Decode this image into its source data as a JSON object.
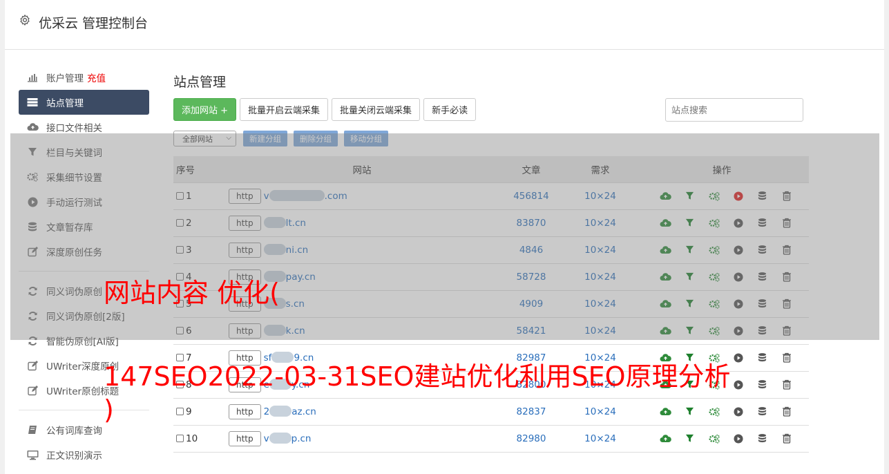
{
  "header": {
    "title": "优采云 管理控制台"
  },
  "sidebar": {
    "group1": [
      {
        "label": "账户管理",
        "extra": "充值",
        "icon": "bar-chart-icon"
      },
      {
        "label": "站点管理",
        "icon": "server-list-icon",
        "active": true
      },
      {
        "label": "接口文件相关",
        "icon": "cloud-upload-icon"
      },
      {
        "label": "栏目与关键词",
        "icon": "filter-icon"
      },
      {
        "label": "采集细节设置",
        "icon": "cogs-icon"
      },
      {
        "label": "手动运行测试",
        "icon": "play-circle-icon"
      },
      {
        "label": "文章暂存库",
        "icon": "database-icon"
      },
      {
        "label": "深度原创任务",
        "icon": "edit-icon"
      }
    ],
    "group2": [
      {
        "label": "同义词伪原创",
        "icon": "refresh-icon"
      },
      {
        "label": "同义词伪原创[2版]",
        "icon": "refresh-icon"
      },
      {
        "label": "智能伪原创[AI版]",
        "icon": "refresh-icon"
      },
      {
        "label": "UWriter深度原创",
        "icon": "edit-icon"
      },
      {
        "label": "UWriter原创标题",
        "icon": "edit-icon"
      }
    ],
    "group3": [
      {
        "label": "公有词库查询",
        "icon": "book-icon"
      },
      {
        "label": "正文识别演示",
        "icon": "monitor-icon"
      }
    ]
  },
  "main": {
    "title": "站点管理",
    "add_button": "添加网站 +",
    "batch_open": "批量开启云端采集",
    "batch_close": "批量关闭云端采集",
    "guide": "新手必读",
    "search_placeholder": "站点搜索",
    "group_select": "全部网站",
    "new_group": "新建分组",
    "delete_group": "删除分组",
    "move_group": "移动分组"
  },
  "table": {
    "headers": {
      "no": "序号",
      "site": "网站",
      "articles": "文章",
      "demand": "需求",
      "ops": "操作"
    },
    "rows": [
      {
        "no": "1",
        "scheme": "http",
        "prefix": "v",
        "suffix": ".com",
        "articles": "456814",
        "demand": "10×24",
        "running": true
      },
      {
        "no": "2",
        "scheme": "http",
        "prefix": "",
        "suffix": "lt.cn",
        "articles": "83870",
        "demand": "10×24",
        "running": false
      },
      {
        "no": "3",
        "scheme": "http",
        "prefix": "",
        "suffix": "ni.cn",
        "articles": "4846",
        "demand": "10×24",
        "running": false
      },
      {
        "no": "4",
        "scheme": "http",
        "prefix": "",
        "suffix": "pay.cn",
        "articles": "58728",
        "demand": "10×24",
        "running": false
      },
      {
        "no": "5",
        "scheme": "http",
        "prefix": "",
        "suffix": "s.cn",
        "articles": "4909",
        "demand": "10×24",
        "running": false
      },
      {
        "no": "6",
        "scheme": "http",
        "prefix": "",
        "suffix": "k.cn",
        "articles": "58421",
        "demand": "10×24",
        "running": false
      },
      {
        "no": "7",
        "scheme": "http",
        "prefix": "sf",
        "suffix": "9.cn",
        "articles": "82987",
        "demand": "10×24",
        "running": false
      },
      {
        "no": "8",
        "scheme": "http",
        "prefix": "e",
        "suffix": "y.cn",
        "articles": "82800",
        "demand": "10×24",
        "running": false
      },
      {
        "no": "9",
        "scheme": "http",
        "prefix": "2",
        "suffix": "az.cn",
        "articles": "82837",
        "demand": "10×24",
        "running": false
      },
      {
        "no": "10",
        "scheme": "http",
        "prefix": "v",
        "suffix": "p.cn",
        "articles": "82980",
        "demand": "10×24",
        "running": false
      }
    ]
  },
  "watermark": {
    "line1": "网站内容 优化(",
    "line2": "147SEO2022-03-31SEO建站优化利用SEO原理分析",
    "line3": ")"
  },
  "colors": {
    "active_nav": "#3c4b64",
    "link": "#2a6ebb",
    "add_button": "#5cb85c",
    "group_button": "#7fa7d8",
    "watermark": "#ff0000"
  }
}
